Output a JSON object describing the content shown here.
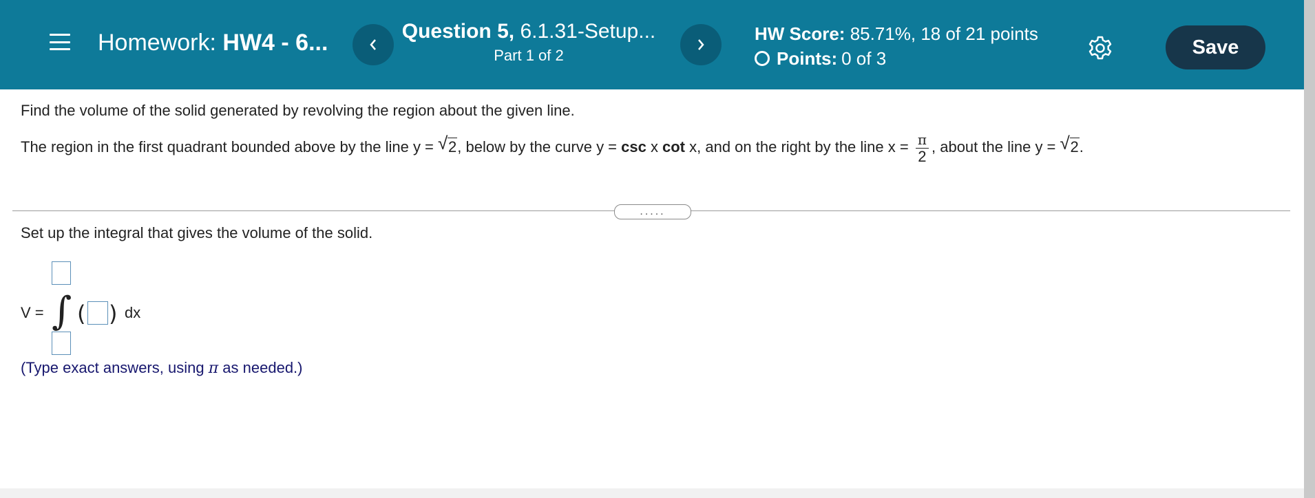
{
  "header": {
    "homework_prefix": "Homework:",
    "homework_name": "HW4 - 6...",
    "question_label": "Question 5,",
    "question_id": "6.1.31-Setup...",
    "part": "Part 1 of 2",
    "score_label": "HW Score:",
    "score_value": "85.71%, 18 of 21 points",
    "points_label": "Points:",
    "points_value": "0 of 3",
    "save_label": "Save",
    "prev_icon": "chevron-left-icon",
    "next_icon": "chevron-right-icon",
    "settings_icon": "gear-icon",
    "menu_icon": "hamburger-menu-icon",
    "colors": {
      "bar": "#0e7a99",
      "nav_button": "#0a5d78",
      "save_button": "#17364a",
      "hint_text": "#17176e"
    }
  },
  "problem": {
    "instruction": "Find the volume of the solid generated by revolving the region about the given line.",
    "region_part1": "The region in the first quadrant bounded above by the line y =",
    "sqrt_arg": "2",
    "region_part2": ", below by the curve y =",
    "csc": "csc",
    "x1": "x",
    "cot": "cot",
    "region_part3": "x, and on the right by the line x =",
    "frac_num": "π",
    "frac_den": "2",
    "region_part4": ", about the line y =",
    "sqrt_arg2": "2",
    "period": "."
  },
  "divider": {
    "handle": "....."
  },
  "answer": {
    "setup_text": "Set up the integral that gives the volume of the solid.",
    "v_label": "V =",
    "integral_symbol": "∫",
    "dx": "dx",
    "upper_limit": "",
    "lower_limit": "",
    "integrand": "",
    "hint_prefix": "(Type exact answers, using",
    "hint_pi": "π",
    "hint_suffix": "as needed.)"
  }
}
